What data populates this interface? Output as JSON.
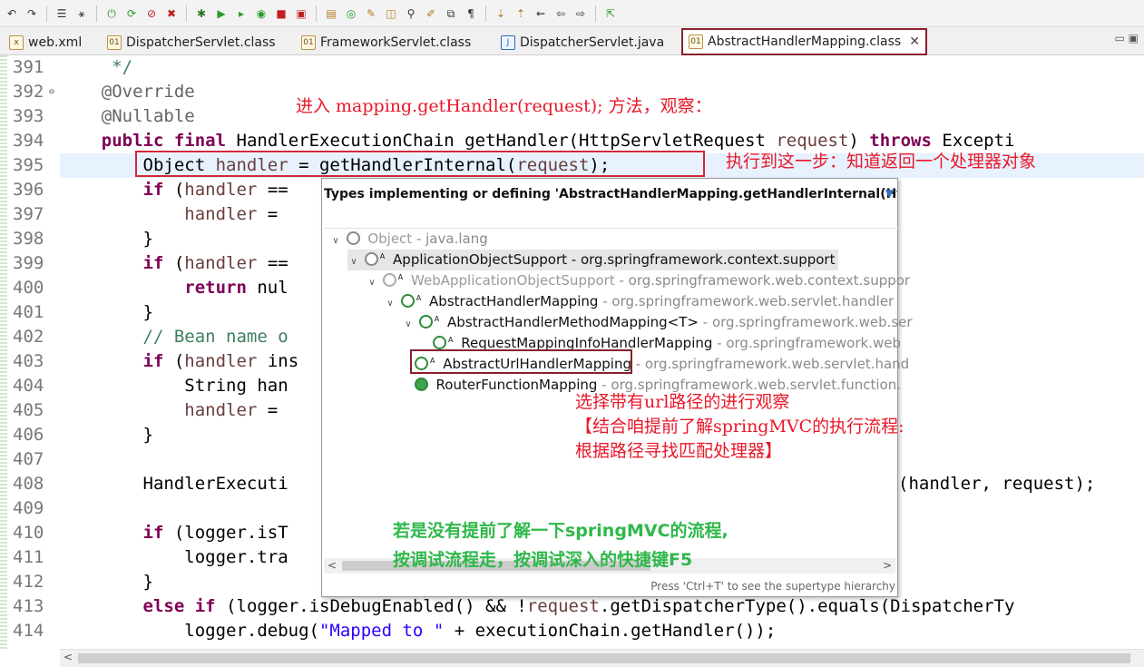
{
  "tabs": [
    {
      "label": "web.xml",
      "icon": "xml-file-icon"
    },
    {
      "label": "DispatcherServlet.class",
      "icon": "class-file-icon"
    },
    {
      "label": "FrameworkServlet.class",
      "icon": "class-file-icon"
    },
    {
      "label": "DispatcherServlet.java",
      "icon": "java-file-icon"
    },
    {
      "label": "AbstractHandlerMapping.class",
      "icon": "class-file-icon",
      "active": true
    }
  ],
  "code_lines": [
    {
      "n": "391",
      "text": "     */"
    },
    {
      "n": "392",
      "text": "    @Override"
    },
    {
      "n": "393",
      "text": "    @Nullable"
    },
    {
      "n": "394",
      "text": "    public final HandlerExecutionChain getHandler(HttpServletRequest request) throws Excepti"
    },
    {
      "n": "395",
      "text": "        Object handler = getHandlerInternal(request);"
    },
    {
      "n": "396",
      "text": "        if (handler =="
    },
    {
      "n": "397",
      "text": "            handler = "
    },
    {
      "n": "398",
      "text": "        }"
    },
    {
      "n": "399",
      "text": "        if (handler =="
    },
    {
      "n": "400",
      "text": "            return nul"
    },
    {
      "n": "401",
      "text": "        }"
    },
    {
      "n": "402",
      "text": "        // Bean name o"
    },
    {
      "n": "403",
      "text": "        if (handler ins"
    },
    {
      "n": "404",
      "text": "            String han"
    },
    {
      "n": "405",
      "text": "            handler = "
    },
    {
      "n": "406",
      "text": "        }"
    },
    {
      "n": "407",
      "text": ""
    },
    {
      "n": "408",
      "text": "        HandlerExecuti"
    },
    {
      "n": "409",
      "text": ""
    },
    {
      "n": "410",
      "text": "        if (logger.isT"
    },
    {
      "n": "411",
      "text": "            logger.tra"
    },
    {
      "n": "412",
      "text": "        }"
    },
    {
      "n": "413",
      "text": "        else if (logger.isDebugEnabled() && !request.getDispatcherType().equals(DispatcherTy"
    },
    {
      "n": "414",
      "text": "            logger.debug(\"Mapped to \" + executionChain.getHandler());"
    }
  ],
  "line408_tail": "(handler, request);",
  "popup": {
    "title": "Types implementing or defining 'AbstractHandlerMapping.getHandlerInternal(Ht",
    "footer": "Press 'Ctrl+T' to see the supertype hierarchy",
    "nodes": [
      {
        "name": "Object",
        "pkg": " - java.lang"
      },
      {
        "name": "ApplicationObjectSupport",
        "pkg": " - org.springframework.context.support"
      },
      {
        "name": "WebApplicationObjectSupport",
        "pkg": " - org.springframework.web.context.suppor"
      },
      {
        "name": "AbstractHandlerMapping",
        "pkg": " - org.springframework.web.servlet.handler"
      },
      {
        "name": "AbstractHandlerMethodMapping<T>",
        "pkg": " - org.springframework.web.ser"
      },
      {
        "name": "RequestMappingInfoHandlerMapping",
        "pkg": " - org.springframework.web"
      },
      {
        "name": "AbstractUrlHandlerMapping",
        "pkg": " - org.springframework.web.servlet.hand"
      },
      {
        "name": "RouterFunctionMapping",
        "pkg": " - org.springframework.web.servlet.function."
      }
    ]
  },
  "notes": {
    "top": "进入 mapping.getHandler(request); 方法，观察：",
    "step": "执行到这一步：知道返回一个处理器对象",
    "select1": "选择带有url路径的进行观察",
    "select2": "【结合咱提前了解springMVC的执行流程:",
    "select3": "根据路径寻找匹配处理器】",
    "green1": "若是没有提前了解一下springMVC的流程,",
    "green2": "按调试流程走，按调试深入的快捷键F5"
  },
  "colors": {
    "annotation_red": "#e8182a",
    "annotation_green": "#2fb84a",
    "highlight_box": "#d0283a",
    "active_tab_border": "#8a1f2d"
  }
}
